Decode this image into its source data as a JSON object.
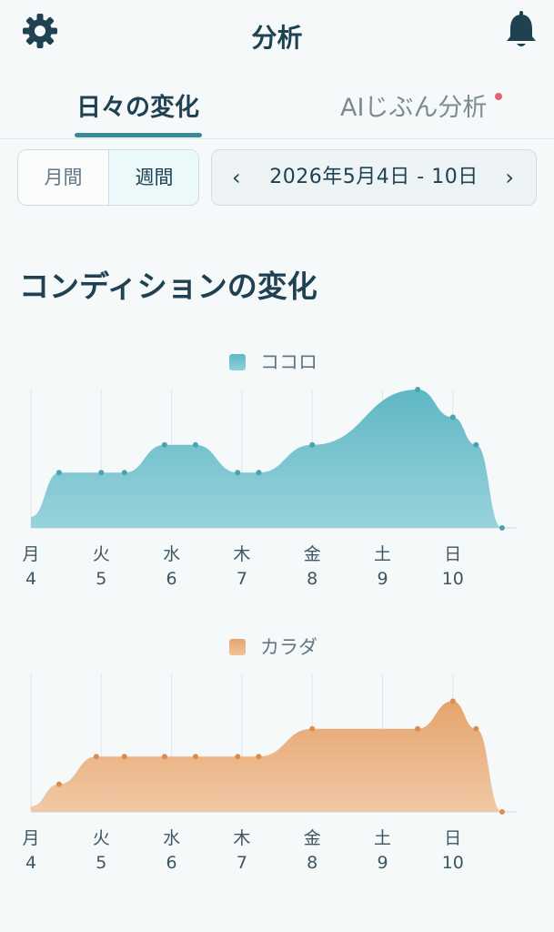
{
  "header": {
    "title": "分析",
    "left_icon": "gear-icon",
    "right_icon": "bell-icon"
  },
  "tabs": [
    {
      "label": "日々の変化",
      "active": true
    },
    {
      "label": "AIじぶん分析",
      "active": false,
      "notification_dot": true
    }
  ],
  "period_toggle": {
    "options": [
      "月間",
      "週間"
    ],
    "selected": "週間"
  },
  "date_range": {
    "label": "2026年5月4日 - 10日",
    "prev_icon": "chevron-left-icon",
    "next_icon": "chevron-right-icon"
  },
  "section_title": "コンディションの変化",
  "colors": {
    "kokoro": "#5fb7c4",
    "karada": "#e6a46c",
    "accent": "#3b8a95",
    "dot": "#e06478"
  },
  "chart_data": [
    {
      "type": "area",
      "title": "ココロ",
      "categories": [
        {
          "day": "月",
          "date": "4"
        },
        {
          "day": "火",
          "date": "5"
        },
        {
          "day": "水",
          "date": "6"
        },
        {
          "day": "木",
          "date": "7"
        },
        {
          "day": "金",
          "date": "8"
        },
        {
          "day": "土",
          "date": "9"
        },
        {
          "day": "日",
          "date": "10"
        }
      ],
      "series": [
        {
          "x": [
            0,
            0.4,
            1.0,
            1.33,
            1.9,
            2.34,
            2.94,
            3.24,
            4.0,
            5.5,
            6.0,
            6.33,
            6.7
          ],
          "values": [
            0.4,
            2,
            2,
            2,
            3,
            3,
            2,
            2,
            3,
            5,
            4,
            3,
            0
          ]
        }
      ],
      "ylim": [
        0,
        5
      ]
    },
    {
      "type": "area",
      "title": "カラダ",
      "categories": [
        {
          "day": "月",
          "date": "4"
        },
        {
          "day": "火",
          "date": "5"
        },
        {
          "day": "水",
          "date": "6"
        },
        {
          "day": "木",
          "date": "7"
        },
        {
          "day": "金",
          "date": "8"
        },
        {
          "day": "土",
          "date": "9"
        },
        {
          "day": "日",
          "date": "10"
        }
      ],
      "series": [
        {
          "x": [
            0,
            0.4,
            0.93,
            1.33,
            1.9,
            2.34,
            2.94,
            3.24,
            4.0,
            5.5,
            6.0,
            6.33,
            6.7
          ],
          "values": [
            0.2,
            1,
            2,
            2,
            2,
            2,
            2,
            2,
            3,
            3,
            4,
            3,
            0
          ]
        }
      ],
      "ylim": [
        0,
        5
      ]
    }
  ]
}
